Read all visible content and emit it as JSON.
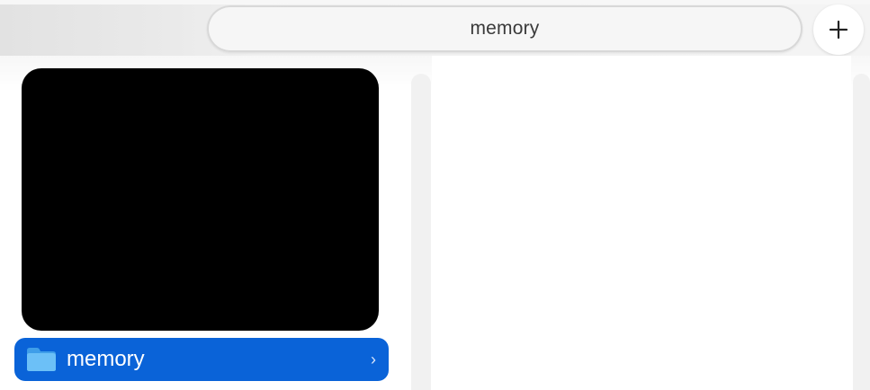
{
  "tabbar": {
    "tabs": [
      {
        "label": "memory",
        "active": true
      }
    ],
    "new_tab_icon": "plus-icon"
  },
  "browser": {
    "selected_item": {
      "label": "memory",
      "icon": "folder-icon",
      "chevron": "›"
    },
    "preview": {
      "type": "thumbnail",
      "color": "#000000"
    }
  },
  "colors": {
    "selection": "#0a63d8",
    "folder": "#5ab4f5"
  }
}
